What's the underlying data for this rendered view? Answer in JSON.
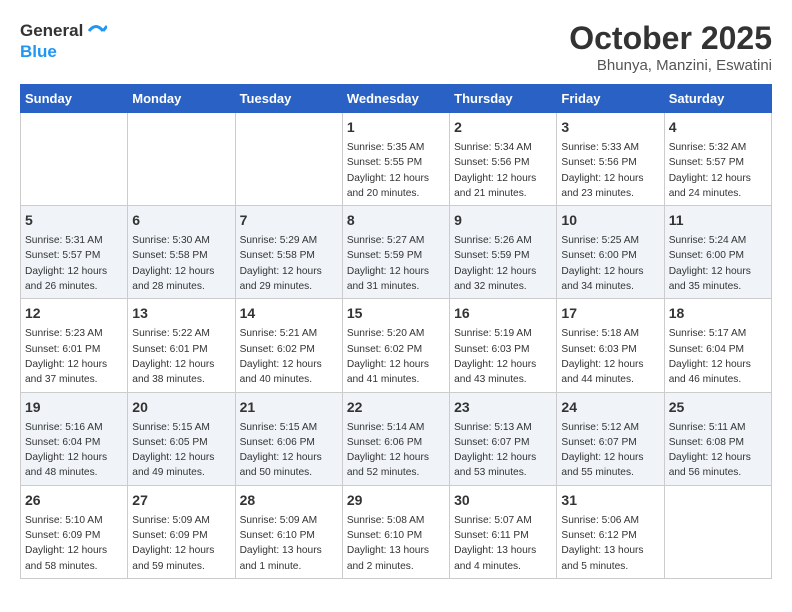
{
  "header": {
    "logo_line1": "General",
    "logo_line2": "Blue",
    "month": "October 2025",
    "location": "Bhunya, Manzini, Eswatini"
  },
  "days_of_week": [
    "Sunday",
    "Monday",
    "Tuesday",
    "Wednesday",
    "Thursday",
    "Friday",
    "Saturday"
  ],
  "weeks": [
    [
      {
        "day": "",
        "info": ""
      },
      {
        "day": "",
        "info": ""
      },
      {
        "day": "",
        "info": ""
      },
      {
        "day": "1",
        "info": "Sunrise: 5:35 AM\nSunset: 5:55 PM\nDaylight: 12 hours\nand 20 minutes."
      },
      {
        "day": "2",
        "info": "Sunrise: 5:34 AM\nSunset: 5:56 PM\nDaylight: 12 hours\nand 21 minutes."
      },
      {
        "day": "3",
        "info": "Sunrise: 5:33 AM\nSunset: 5:56 PM\nDaylight: 12 hours\nand 23 minutes."
      },
      {
        "day": "4",
        "info": "Sunrise: 5:32 AM\nSunset: 5:57 PM\nDaylight: 12 hours\nand 24 minutes."
      }
    ],
    [
      {
        "day": "5",
        "info": "Sunrise: 5:31 AM\nSunset: 5:57 PM\nDaylight: 12 hours\nand 26 minutes."
      },
      {
        "day": "6",
        "info": "Sunrise: 5:30 AM\nSunset: 5:58 PM\nDaylight: 12 hours\nand 28 minutes."
      },
      {
        "day": "7",
        "info": "Sunrise: 5:29 AM\nSunset: 5:58 PM\nDaylight: 12 hours\nand 29 minutes."
      },
      {
        "day": "8",
        "info": "Sunrise: 5:27 AM\nSunset: 5:59 PM\nDaylight: 12 hours\nand 31 minutes."
      },
      {
        "day": "9",
        "info": "Sunrise: 5:26 AM\nSunset: 5:59 PM\nDaylight: 12 hours\nand 32 minutes."
      },
      {
        "day": "10",
        "info": "Sunrise: 5:25 AM\nSunset: 6:00 PM\nDaylight: 12 hours\nand 34 minutes."
      },
      {
        "day": "11",
        "info": "Sunrise: 5:24 AM\nSunset: 6:00 PM\nDaylight: 12 hours\nand 35 minutes."
      }
    ],
    [
      {
        "day": "12",
        "info": "Sunrise: 5:23 AM\nSunset: 6:01 PM\nDaylight: 12 hours\nand 37 minutes."
      },
      {
        "day": "13",
        "info": "Sunrise: 5:22 AM\nSunset: 6:01 PM\nDaylight: 12 hours\nand 38 minutes."
      },
      {
        "day": "14",
        "info": "Sunrise: 5:21 AM\nSunset: 6:02 PM\nDaylight: 12 hours\nand 40 minutes."
      },
      {
        "day": "15",
        "info": "Sunrise: 5:20 AM\nSunset: 6:02 PM\nDaylight: 12 hours\nand 41 minutes."
      },
      {
        "day": "16",
        "info": "Sunrise: 5:19 AM\nSunset: 6:03 PM\nDaylight: 12 hours\nand 43 minutes."
      },
      {
        "day": "17",
        "info": "Sunrise: 5:18 AM\nSunset: 6:03 PM\nDaylight: 12 hours\nand 44 minutes."
      },
      {
        "day": "18",
        "info": "Sunrise: 5:17 AM\nSunset: 6:04 PM\nDaylight: 12 hours\nand 46 minutes."
      }
    ],
    [
      {
        "day": "19",
        "info": "Sunrise: 5:16 AM\nSunset: 6:04 PM\nDaylight: 12 hours\nand 48 minutes."
      },
      {
        "day": "20",
        "info": "Sunrise: 5:15 AM\nSunset: 6:05 PM\nDaylight: 12 hours\nand 49 minutes."
      },
      {
        "day": "21",
        "info": "Sunrise: 5:15 AM\nSunset: 6:06 PM\nDaylight: 12 hours\nand 50 minutes."
      },
      {
        "day": "22",
        "info": "Sunrise: 5:14 AM\nSunset: 6:06 PM\nDaylight: 12 hours\nand 52 minutes."
      },
      {
        "day": "23",
        "info": "Sunrise: 5:13 AM\nSunset: 6:07 PM\nDaylight: 12 hours\nand 53 minutes."
      },
      {
        "day": "24",
        "info": "Sunrise: 5:12 AM\nSunset: 6:07 PM\nDaylight: 12 hours\nand 55 minutes."
      },
      {
        "day": "25",
        "info": "Sunrise: 5:11 AM\nSunset: 6:08 PM\nDaylight: 12 hours\nand 56 minutes."
      }
    ],
    [
      {
        "day": "26",
        "info": "Sunrise: 5:10 AM\nSunset: 6:09 PM\nDaylight: 12 hours\nand 58 minutes."
      },
      {
        "day": "27",
        "info": "Sunrise: 5:09 AM\nSunset: 6:09 PM\nDaylight: 12 hours\nand 59 minutes."
      },
      {
        "day": "28",
        "info": "Sunrise: 5:09 AM\nSunset: 6:10 PM\nDaylight: 13 hours\nand 1 minute."
      },
      {
        "day": "29",
        "info": "Sunrise: 5:08 AM\nSunset: 6:10 PM\nDaylight: 13 hours\nand 2 minutes."
      },
      {
        "day": "30",
        "info": "Sunrise: 5:07 AM\nSunset: 6:11 PM\nDaylight: 13 hours\nand 4 minutes."
      },
      {
        "day": "31",
        "info": "Sunrise: 5:06 AM\nSunset: 6:12 PM\nDaylight: 13 hours\nand 5 minutes."
      },
      {
        "day": "",
        "info": ""
      }
    ]
  ]
}
